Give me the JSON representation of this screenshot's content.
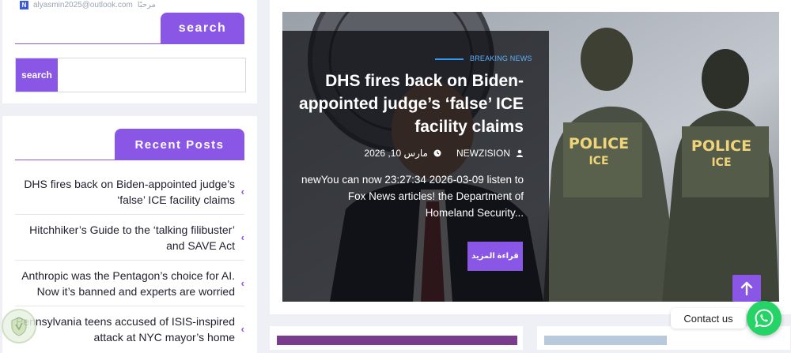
{
  "sidebar": {
    "user_line": {
      "email": "alyasmin2025@outlook.com",
      "greeting": "مرحبًا",
      "badge": "N"
    },
    "search_widget": {
      "title": "search",
      "button_label": "search",
      "input_placeholder": ""
    },
    "recent_posts": {
      "title": "Recent Posts",
      "items": [
        {
          "title": "DHS fires back on Biden-appointed judge’s ‘false’ ICE facility claims"
        },
        {
          "title": "Hitchhiker’s Guide to the ‘talking filibuster’ and SAVE Act"
        },
        {
          "title": "Anthropic was the Pentagon’s choice for AI. Now it’s banned and experts are worried"
        },
        {
          "title": "Pennsylvania teens accused of ISIS-inspired attack at NYC mayor’s home"
        }
      ],
      "chevron_icon": "chevron-left-icon"
    }
  },
  "hero": {
    "tag": "BREAKING NEWS",
    "title": "DHS fires back on Biden-appointed judge’s ‘false’ ICE facility claims",
    "author": "NEWZISION",
    "date": "مارس 10, 2026",
    "excerpt": "newYou can now 23:27:34 2026-03-09 listen to Fox News articles! the Department of Homeland Security...",
    "read_more": "قراءة المزيد",
    "image_text": {
      "badge_left_line1": "POLICE",
      "badge_left_line2": "ICE",
      "badge_right_line1": "POLICE",
      "badge_right_line2": "ICE"
    }
  },
  "floating": {
    "contact_label": "Contact us",
    "scroll_up_icon": "arrow-up-icon",
    "whatsapp_icon": "whatsapp-icon"
  },
  "colors": {
    "accent": "#8a56e6",
    "breaking_blue": "#2f9af0",
    "whatsapp": "#25d366",
    "page_bg": "#eef0f5"
  }
}
